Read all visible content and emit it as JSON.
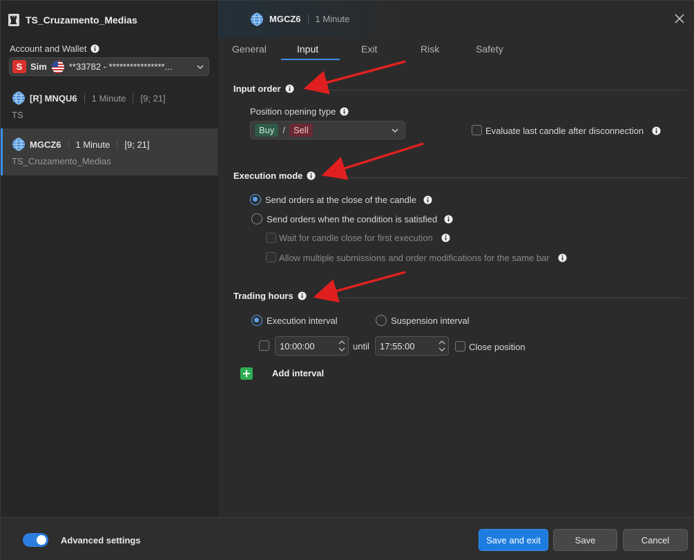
{
  "sidebar": {
    "title": "TS_Cruzamento_Medias",
    "account_label": "Account and Wallet",
    "account": {
      "badge": "S",
      "type": "Sim",
      "number": "**33782 - ****************..."
    },
    "strategies": [
      {
        "symbol": "[R] MNQU6",
        "timeframe": "1 Minute",
        "params": "[9; 21]",
        "name": "TS"
      },
      {
        "symbol": "MGCZ6",
        "timeframe": "1 Minute",
        "params": "[9; 21]",
        "name": "TS_Cruzamento_Medias"
      }
    ]
  },
  "header": {
    "symbol": "MGCZ6",
    "timeframe": "1 Minute"
  },
  "tabs": [
    {
      "label": "General"
    },
    {
      "label": "Input"
    },
    {
      "label": "Exit"
    },
    {
      "label": "Risk"
    },
    {
      "label": "Safety"
    }
  ],
  "input_order": {
    "title": "Input order",
    "position_label": "Position opening type",
    "buy": "Buy",
    "slash": "/",
    "sell": "Sell",
    "evaluate_label": "Evaluate last candle after disconnection"
  },
  "execution_mode": {
    "title": "Execution mode",
    "option_close": "Send orders at the close of the candle",
    "option_condition": "Send orders when the condition is satisfied",
    "wait_label": "Wait for candle close for first execution",
    "allow_label": "Allow multiple submissions and order modifications for the same bar"
  },
  "trading_hours": {
    "title": "Trading hours",
    "execution_interval": "Execution interval",
    "suspension_interval": "Suspension interval",
    "start_time": "10:00:00",
    "until": "until",
    "end_time": "17:55:00",
    "close_position": "Close position",
    "add_interval": "Add interval"
  },
  "footer": {
    "advanced_settings": "Advanced settings",
    "save_exit": "Save and exit",
    "save": "Save",
    "cancel": "Cancel"
  },
  "colors": {
    "accent": "#1d7ce0",
    "buy_pill": "#2f5a47",
    "sell_pill": "#6a2a34",
    "add_green": "#2fae53",
    "annotation_arrow": "#e02020"
  }
}
